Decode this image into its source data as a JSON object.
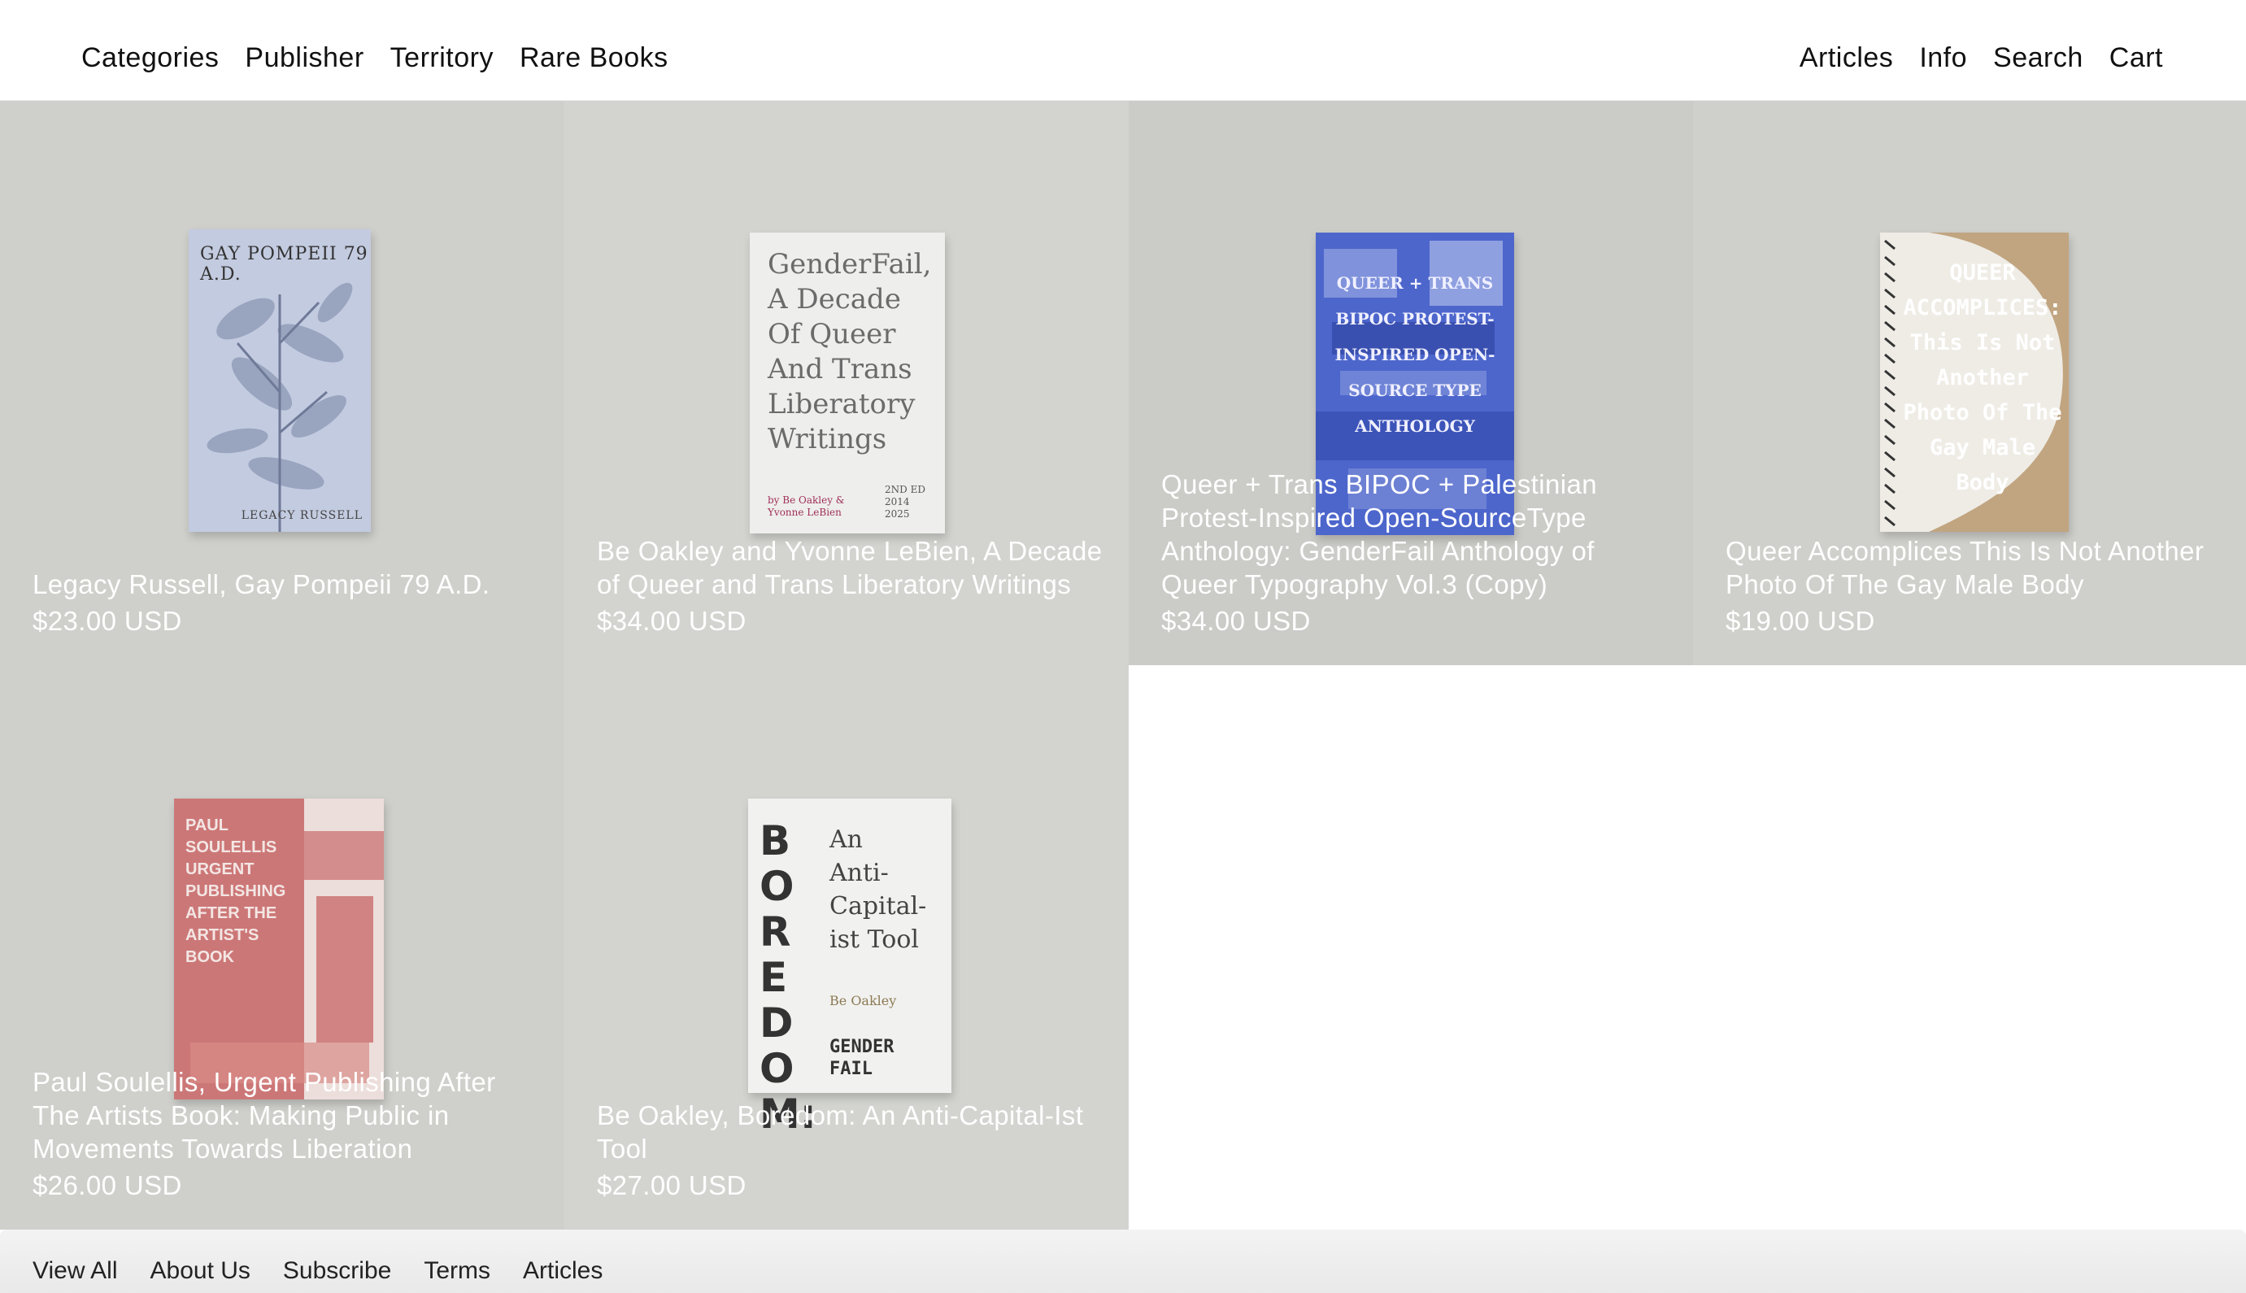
{
  "nav": {
    "left": [
      "Categories",
      "Publisher",
      "Territory",
      "Rare Books"
    ],
    "right": [
      "Articles",
      "Info",
      "Search",
      "Cart"
    ]
  },
  "products": [
    {
      "title": "Legacy Russell, Gay Pompeii 79 A.D.",
      "price": "$23.00 USD",
      "cover_title": "GAY POMPEII 79 A.D.",
      "cover_author": "LEGACY RUSSELL",
      "cover_color": "#b9c3d8"
    },
    {
      "title": "Be Oakley and Yvonne LeBien, A Decade of Queer and Trans Liberatory Writings",
      "price": "$34.00 USD",
      "cover_title": "GenderFail, A Decade Of Queer And Trans Liberatory Writings",
      "cover_author": "by Be Oakley & Yvonne LeBien",
      "cover_edition": "2ND ED 2014 2025",
      "cover_color": "#eeeeec"
    },
    {
      "title": "Queer + Trans BIPOC + Palestinian Protest-Inspired Open-SourceType Anthology: GenderFail Anthology of Queer Typography Vol.3 (Copy)",
      "price": "$34.00 USD",
      "cover_title": "QUEER + TRANS BIPOC PROTEST-INSPIRED OPEN-SOURCE TYPE ANTHOLOGY",
      "cover_color": "#4a63c9"
    },
    {
      "title": "Queer Accomplices This Is Not Another Photo Of The Gay Male Body",
      "price": "$19.00 USD",
      "cover_title": "QUEER ACCOMPLICES: This Is Not Another Photo Of The Gay Male Body",
      "cover_color": "#efece6"
    },
    {
      "title": "Paul Soulellis, Urgent Publishing After The Artists Book: Making Public in Movements Towards Liberation",
      "price": "$26.00 USD",
      "cover_title": "PAUL SOULELLIS URGENT PUBLISHING AFTER THE ARTIST'S BOOK",
      "cover_color": "#c96b6b"
    },
    {
      "title": "Be Oakley, Boredom: An Anti-Capital-Ist Tool",
      "price": "$27.00 USD",
      "cover_title": "BOREDOM:",
      "cover_subtitle": "An Anti-Capital-ist Tool",
      "cover_author": "Be Oakley",
      "cover_publisher": "GENDER FAIL",
      "cover_color": "#f1f1ef"
    }
  ],
  "footer": {
    "links": [
      "View All",
      "About Us",
      "Subscribe",
      "Terms",
      "Articles"
    ]
  }
}
